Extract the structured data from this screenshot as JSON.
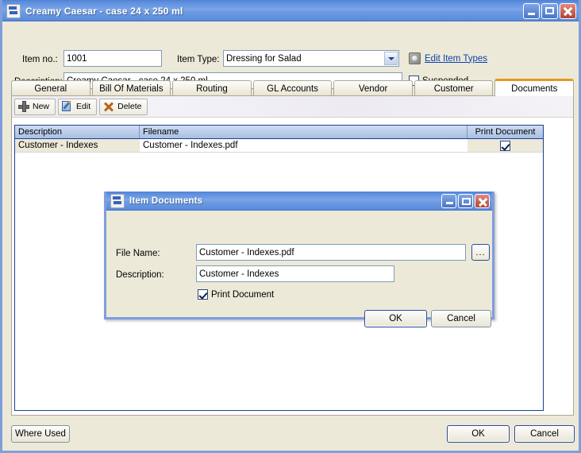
{
  "window": {
    "title": "Creamy Caesar - case 24 x 250 ml",
    "icon": "window-app-icon",
    "minimize": "minimize-icon",
    "maximize": "maximize-icon",
    "close": "close-icon"
  },
  "header": {
    "item_no_label": "Item no.:",
    "item_no_value": "1001",
    "item_type_label": "Item Type:",
    "item_type_value": "Dressing for Salad",
    "description_label": "Description:",
    "description_value": "Creamy Caesar - case 24 x 250 ml",
    "edit_item_types_link": "Edit Item Types",
    "suspended_label": "Suspended",
    "suspended_checked": false
  },
  "tabs": [
    {
      "label": "General",
      "active": false
    },
    {
      "label": "Bill Of Materials",
      "active": false
    },
    {
      "label": "Routing",
      "active": false
    },
    {
      "label": "GL Accounts",
      "active": false
    },
    {
      "label": "Vendor",
      "active": false
    },
    {
      "label": "Customer",
      "active": false
    },
    {
      "label": "Documents",
      "active": true
    }
  ],
  "toolbar": {
    "new_label": "New",
    "edit_label": "Edit",
    "delete_label": "Delete"
  },
  "grid": {
    "columns": [
      "Description",
      "Filename",
      "Print Document"
    ],
    "rows": [
      {
        "description": "Customer - Indexes",
        "filename": "Customer - Indexes.pdf",
        "print_document": true
      }
    ]
  },
  "footer": {
    "where_used_label": "Where Used",
    "ok_label": "OK",
    "cancel_label": "Cancel"
  },
  "dialog": {
    "title": "Item Documents",
    "icon": "window-app-icon",
    "file_name_label": "File Name:",
    "file_name_value": "Customer - Indexes.pdf",
    "browse_label": "...",
    "description_label": "Description:",
    "description_value": "Customer - Indexes",
    "print_document_label": "Print Document",
    "print_document_checked": true,
    "ok_label": "OK",
    "cancel_label": "Cancel"
  },
  "colors": {
    "titlebar_blue": "#6f9ce4",
    "window_face": "#ece9d8",
    "active_tab_accent": "#e89820",
    "grid_header": "#a8c0e4",
    "link_blue": "#0b41a8"
  }
}
